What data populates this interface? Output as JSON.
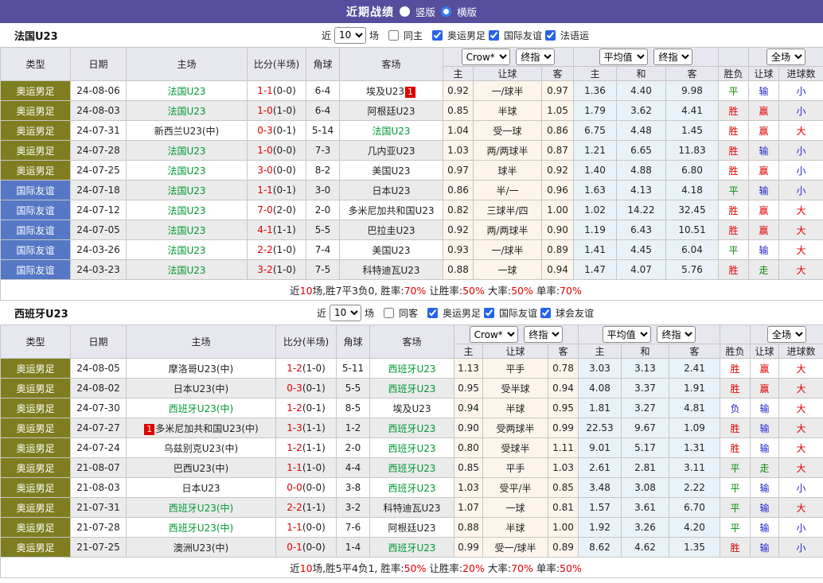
{
  "titlebar": {
    "title": "近期战绩",
    "modes": [
      {
        "label": "竖版",
        "selected": false
      },
      {
        "label": "横版",
        "selected": true
      }
    ]
  },
  "colors": {
    "titlebar_bg": "#564E9D",
    "oly_bg": "#7E7E20",
    "friendly_bg": "#5577C5",
    "focus_team": "#009933",
    "red": "#E10000",
    "blue": "#2323CD",
    "green": "#0A8A0A",
    "odds_bg": "#FDF5EC",
    "avg_bg": "#E9F2F8",
    "header_bg": "#E7E7F0",
    "alt_row": "#EBEBEB"
  },
  "tables": [
    {
      "team_label": "法国U23",
      "filter": {
        "near_label": "近",
        "count": "10",
        "suffix": "场",
        "same_label": "同主",
        "same_checked": false,
        "leagues": [
          {
            "label": "奥运男足",
            "checked": true
          },
          {
            "label": "国际友谊",
            "checked": true
          },
          {
            "label": "法语运",
            "checked": true
          }
        ]
      },
      "header": {
        "cols": [
          "类型",
          "日期",
          "主场",
          "比分(半场)",
          "角球",
          "客场"
        ],
        "selects": {
          "odds_source": "Crow*",
          "odds_final": "终指",
          "avg_source": "平均值",
          "avg_final": "终指",
          "scope": "全场"
        },
        "sub": [
          "主",
          "让球",
          "客",
          "主",
          "和",
          "客",
          "胜负",
          "让球",
          "进球数"
        ]
      },
      "rows": [
        {
          "type": "奥运男足",
          "tc": "oly",
          "date": "24-08-06",
          "home": {
            "n": "法国U23",
            "f": 1
          },
          "ft": "1-1",
          "ht": "(0-0)",
          "corner": "6-4",
          "away": {
            "n": "埃及U23",
            "b": "1",
            "bp": "after"
          },
          "o1": "0.92",
          "hc": "一/球半",
          "o2": "0.97",
          "a1": "1.36",
          "a2": "4.40",
          "a3": "9.98",
          "res": [
            "平",
            "g"
          ],
          "hr": [
            "输",
            "b"
          ],
          "go": [
            "小",
            "b"
          ]
        },
        {
          "type": "奥运男足",
          "tc": "oly",
          "date": "24-08-03",
          "home": {
            "n": "法国U23",
            "f": 1
          },
          "ft": "1-0",
          "ht": "(1-0)",
          "corner": "6-4",
          "away": {
            "n": "阿根廷U23"
          },
          "o1": "0.85",
          "hc": "半球",
          "o2": "1.05",
          "a1": "1.79",
          "a2": "3.62",
          "a3": "4.41",
          "res": [
            "胜",
            "r"
          ],
          "hr": [
            "赢",
            "r"
          ],
          "go": [
            "小",
            "b"
          ]
        },
        {
          "type": "奥运男足",
          "tc": "oly",
          "date": "24-07-31",
          "home": {
            "n": "新西兰U23(中)"
          },
          "ft": "0-3",
          "ht": "(0-1)",
          "corner": "5-14",
          "away": {
            "n": "法国U23",
            "f": 1
          },
          "o1": "1.04",
          "hc": "受一球",
          "o2": "0.86",
          "a1": "6.75",
          "a2": "4.48",
          "a3": "1.45",
          "res": [
            "胜",
            "r"
          ],
          "hr": [
            "赢",
            "r"
          ],
          "go": [
            "大",
            "r"
          ]
        },
        {
          "type": "奥运男足",
          "tc": "oly",
          "date": "24-07-28",
          "home": {
            "n": "法国U23",
            "f": 1
          },
          "ft": "1-0",
          "ht": "(0-0)",
          "corner": "7-3",
          "away": {
            "n": "几内亚U23"
          },
          "o1": "1.03",
          "hc": "两/两球半",
          "o2": "0.87",
          "a1": "1.21",
          "a2": "6.65",
          "a3": "11.83",
          "res": [
            "胜",
            "r"
          ],
          "hr": [
            "输",
            "b"
          ],
          "go": [
            "小",
            "b"
          ]
        },
        {
          "type": "奥运男足",
          "tc": "oly",
          "date": "24-07-25",
          "home": {
            "n": "法国U23",
            "f": 1
          },
          "ft": "3-0",
          "ht": "(0-0)",
          "corner": "8-2",
          "away": {
            "n": "美国U23"
          },
          "o1": "0.97",
          "hc": "球半",
          "o2": "0.92",
          "a1": "1.40",
          "a2": "4.88",
          "a3": "6.80",
          "res": [
            "胜",
            "r"
          ],
          "hr": [
            "赢",
            "r"
          ],
          "go": [
            "小",
            "b"
          ]
        },
        {
          "type": "国际友谊",
          "tc": "fr",
          "date": "24-07-18",
          "home": {
            "n": "法国U23",
            "f": 1
          },
          "ft": "1-1",
          "ht": "(0-1)",
          "corner": "3-0",
          "away": {
            "n": "日本U23"
          },
          "o1": "0.86",
          "hc": "半/一",
          "o2": "0.96",
          "a1": "1.63",
          "a2": "4.13",
          "a3": "4.18",
          "res": [
            "平",
            "g"
          ],
          "hr": [
            "输",
            "b"
          ],
          "go": [
            "小",
            "b"
          ]
        },
        {
          "type": "国际友谊",
          "tc": "fr",
          "date": "24-07-12",
          "home": {
            "n": "法国U23",
            "f": 1
          },
          "ft": "7-0",
          "ht": "(2-0)",
          "corner": "2-0",
          "away": {
            "n": "多米尼加共和国U23"
          },
          "o1": "0.82",
          "hc": "三球半/四",
          "o2": "1.00",
          "a1": "1.02",
          "a2": "14.22",
          "a3": "32.45",
          "res": [
            "胜",
            "r"
          ],
          "hr": [
            "赢",
            "r"
          ],
          "go": [
            "大",
            "r"
          ]
        },
        {
          "type": "国际友谊",
          "tc": "fr",
          "date": "24-07-05",
          "home": {
            "n": "法国U23",
            "f": 1
          },
          "ft": "4-1",
          "ht": "(1-1)",
          "corner": "5-5",
          "away": {
            "n": "巴拉圭U23"
          },
          "o1": "0.92",
          "hc": "两/两球半",
          "o2": "0.90",
          "a1": "1.19",
          "a2": "6.43",
          "a3": "10.51",
          "res": [
            "胜",
            "r"
          ],
          "hr": [
            "赢",
            "r"
          ],
          "go": [
            "大",
            "r"
          ]
        },
        {
          "type": "国际友谊",
          "tc": "fr",
          "date": "24-03-26",
          "home": {
            "n": "法国U23",
            "f": 1
          },
          "ft": "2-2",
          "ht": "(1-0)",
          "corner": "7-4",
          "away": {
            "n": "美国U23"
          },
          "o1": "0.93",
          "hc": "一/球半",
          "o2": "0.89",
          "a1": "1.41",
          "a2": "4.45",
          "a3": "6.04",
          "res": [
            "平",
            "g"
          ],
          "hr": [
            "输",
            "b"
          ],
          "go": [
            "大",
            "r"
          ]
        },
        {
          "type": "国际友谊",
          "tc": "fr",
          "date": "24-03-23",
          "home": {
            "n": "法国U23",
            "f": 1
          },
          "ft": "3-2",
          "ht": "(1-0)",
          "corner": "7-5",
          "away": {
            "n": "科特迪瓦U23"
          },
          "o1": "0.88",
          "hc": "一球",
          "o2": "0.94",
          "a1": "1.47",
          "a2": "4.07",
          "a3": "5.76",
          "res": [
            "胜",
            "r"
          ],
          "hr": [
            "走",
            "g"
          ],
          "go": [
            "大",
            "r"
          ]
        }
      ],
      "summary": [
        {
          "t": "近"
        },
        {
          "t": "10",
          "red": true
        },
        {
          "t": "场,胜7平3负0, 胜率:"
        },
        {
          "t": "70%",
          "red": true
        },
        {
          "t": " 让胜率:"
        },
        {
          "t": "50%",
          "red": true
        },
        {
          "t": " 大率:"
        },
        {
          "t": "50%",
          "red": true
        },
        {
          "t": " 单率:"
        },
        {
          "t": "70%",
          "red": true
        }
      ]
    },
    {
      "team_label": "西班牙U23",
      "filter": {
        "near_label": "近",
        "count": "10",
        "suffix": "场",
        "same_label": "同客",
        "same_checked": false,
        "leagues": [
          {
            "label": "奥运男足",
            "checked": true
          },
          {
            "label": "国际友谊",
            "checked": true
          },
          {
            "label": "球会友谊",
            "checked": true
          }
        ]
      },
      "header": {
        "cols": [
          "类型",
          "日期",
          "主场",
          "比分(半场)",
          "角球",
          "客场"
        ],
        "selects": {
          "odds_source": "Crow*",
          "odds_final": "终指",
          "avg_source": "平均值",
          "avg_final": "终指",
          "scope": "全场"
        },
        "sub": [
          "主",
          "让球",
          "客",
          "主",
          "和",
          "客",
          "胜负",
          "让球",
          "进球数"
        ]
      },
      "rows": [
        {
          "type": "奥运男足",
          "tc": "oly",
          "date": "24-08-05",
          "home": {
            "n": "摩洛哥U23(中)"
          },
          "ft": "1-2",
          "ht": "(1-0)",
          "corner": "5-11",
          "away": {
            "n": "西班牙U23",
            "f": 1
          },
          "o1": "1.13",
          "hc": "平手",
          "o2": "0.78",
          "a1": "3.03",
          "a2": "3.13",
          "a3": "2.41",
          "res": [
            "胜",
            "r"
          ],
          "hr": [
            "赢",
            "r"
          ],
          "go": [
            "大",
            "r"
          ]
        },
        {
          "type": "奥运男足",
          "tc": "oly",
          "date": "24-08-02",
          "home": {
            "n": "日本U23(中)"
          },
          "ft": "0-3",
          "ht": "(0-1)",
          "corner": "5-5",
          "away": {
            "n": "西班牙U23",
            "f": 1
          },
          "o1": "0.95",
          "hc": "受半球",
          "o2": "0.94",
          "a1": "4.08",
          "a2": "3.37",
          "a3": "1.91",
          "res": [
            "胜",
            "r"
          ],
          "hr": [
            "赢",
            "r"
          ],
          "go": [
            "大",
            "r"
          ]
        },
        {
          "type": "奥运男足",
          "tc": "oly",
          "date": "24-07-30",
          "home": {
            "n": "西班牙U23(中)",
            "f": 1
          },
          "ft": "1-2",
          "ht": "(0-1)",
          "corner": "8-5",
          "away": {
            "n": "埃及U23"
          },
          "o1": "0.94",
          "hc": "半球",
          "o2": "0.95",
          "a1": "1.81",
          "a2": "3.27",
          "a3": "4.81",
          "res": [
            "负",
            "b"
          ],
          "hr": [
            "输",
            "b"
          ],
          "go": [
            "大",
            "r"
          ]
        },
        {
          "type": "奥运男足",
          "tc": "oly",
          "date": "24-07-27",
          "home": {
            "n": "多米尼加共和国U23(中)",
            "b": "1",
            "bp": "before"
          },
          "ft": "1-3",
          "ht": "(1-1)",
          "corner": "1-2",
          "away": {
            "n": "西班牙U23",
            "f": 1
          },
          "o1": "0.90",
          "hc": "受两球半",
          "o2": "0.99",
          "a1": "22.53",
          "a2": "9.67",
          "a3": "1.09",
          "res": [
            "胜",
            "r"
          ],
          "hr": [
            "输",
            "b"
          ],
          "go": [
            "大",
            "r"
          ]
        },
        {
          "type": "奥运男足",
          "tc": "oly",
          "date": "24-07-24",
          "home": {
            "n": "乌兹别克U23(中)"
          },
          "ft": "1-2",
          "ht": "(1-1)",
          "corner": "2-0",
          "away": {
            "n": "西班牙U23",
            "f": 1
          },
          "o1": "0.80",
          "hc": "受球半",
          "o2": "1.11",
          "a1": "9.01",
          "a2": "5.17",
          "a3": "1.31",
          "res": [
            "胜",
            "r"
          ],
          "hr": [
            "输",
            "b"
          ],
          "go": [
            "大",
            "r"
          ]
        },
        {
          "type": "奥运男足",
          "tc": "oly",
          "date": "21-08-07",
          "home": {
            "n": "巴西U23(中)"
          },
          "ft": "1-1",
          "ht": "(1-0)",
          "corner": "4-4",
          "away": {
            "n": "西班牙U23",
            "f": 1
          },
          "o1": "0.85",
          "hc": "平手",
          "o2": "1.03",
          "a1": "2.61",
          "a2": "2.81",
          "a3": "3.11",
          "res": [
            "平",
            "g"
          ],
          "hr": [
            "走",
            "g"
          ],
          "go": [
            "大",
            "r"
          ]
        },
        {
          "type": "奥运男足",
          "tc": "oly",
          "date": "21-08-03",
          "home": {
            "n": "日本U23"
          },
          "ft": "0-0",
          "ht": "(0-0)",
          "corner": "3-8",
          "away": {
            "n": "西班牙U23",
            "f": 1
          },
          "o1": "1.03",
          "hc": "受平/半",
          "o2": "0.85",
          "a1": "3.48",
          "a2": "3.08",
          "a3": "2.22",
          "res": [
            "平",
            "g"
          ],
          "hr": [
            "输",
            "b"
          ],
          "go": [
            "小",
            "b"
          ]
        },
        {
          "type": "奥运男足",
          "tc": "oly",
          "date": "21-07-31",
          "home": {
            "n": "西班牙U23(中)",
            "f": 1
          },
          "ft": "2-2",
          "ht": "(1-1)",
          "corner": "3-2",
          "away": {
            "n": "科特迪瓦U23"
          },
          "o1": "1.07",
          "hc": "一球",
          "o2": "0.81",
          "a1": "1.57",
          "a2": "3.61",
          "a3": "6.70",
          "res": [
            "平",
            "g"
          ],
          "hr": [
            "输",
            "b"
          ],
          "go": [
            "大",
            "r"
          ]
        },
        {
          "type": "奥运男足",
          "tc": "oly",
          "date": "21-07-28",
          "home": {
            "n": "西班牙U23(中)",
            "f": 1
          },
          "ft": "1-1",
          "ht": "(0-0)",
          "corner": "7-6",
          "away": {
            "n": "阿根廷U23"
          },
          "o1": "0.88",
          "hc": "半球",
          "o2": "1.00",
          "a1": "1.92",
          "a2": "3.26",
          "a3": "4.20",
          "res": [
            "平",
            "g"
          ],
          "hr": [
            "输",
            "b"
          ],
          "go": [
            "小",
            "b"
          ]
        },
        {
          "type": "奥运男足",
          "tc": "oly",
          "date": "21-07-25",
          "home": {
            "n": "澳洲U23(中)"
          },
          "ft": "0-1",
          "ht": "(0-0)",
          "corner": "1-4",
          "away": {
            "n": "西班牙U23",
            "f": 1
          },
          "o1": "0.99",
          "hc": "受一/球半",
          "o2": "0.89",
          "a1": "8.62",
          "a2": "4.62",
          "a3": "1.35",
          "res": [
            "胜",
            "r"
          ],
          "hr": [
            "输",
            "b"
          ],
          "go": [
            "小",
            "b"
          ]
        }
      ],
      "summary": [
        {
          "t": "近"
        },
        {
          "t": "10",
          "red": true
        },
        {
          "t": "场,胜5平4负1, 胜率:"
        },
        {
          "t": "50%",
          "red": true
        },
        {
          "t": " 让胜率:"
        },
        {
          "t": "20%",
          "red": true
        },
        {
          "t": " 大率:"
        },
        {
          "t": "70%",
          "red": true
        },
        {
          "t": " 单率:"
        },
        {
          "t": "50%",
          "red": true
        }
      ]
    }
  ]
}
